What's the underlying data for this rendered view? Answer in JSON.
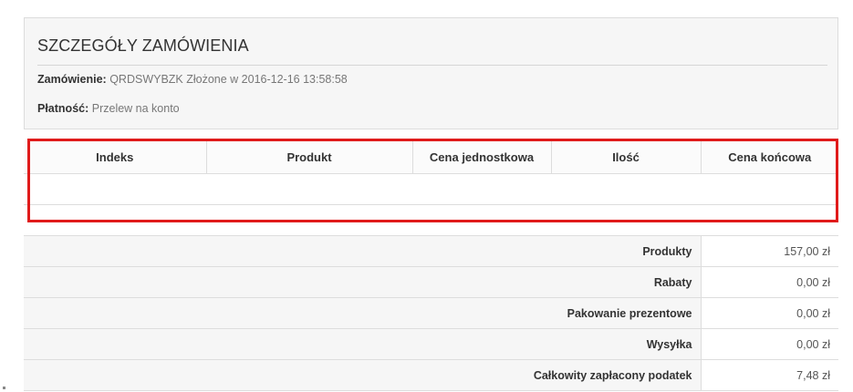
{
  "details": {
    "title": "SZCZEGÓŁY ZAMÓWIENIA",
    "order_label": "Zamówienie:",
    "order_value": "QRDSWYBZK Złożone w 2016-12-16 13:58:58",
    "payment_label": "Płatność:",
    "payment_value": "Przelew na konto"
  },
  "products_table": {
    "columns": [
      "Indeks",
      "Produkt",
      "Cena jednostkowa",
      "Ilość",
      "Cena końcowa"
    ],
    "rows": [
      [
        "",
        "",
        "",
        "",
        ""
      ],
      [
        "",
        "",
        "",
        "",
        ""
      ]
    ]
  },
  "totals": [
    {
      "label": "Produkty",
      "value": "157,00 zł"
    },
    {
      "label": "Rabaty",
      "value": "0,00 zł"
    },
    {
      "label": "Pakowanie prezentowe",
      "value": "0,00 zł"
    },
    {
      "label": "Wysyłka",
      "value": "0,00 zł"
    },
    {
      "label": "Całkowity zapłacony podatek",
      "value": "7,48 zł"
    }
  ],
  "colors": {
    "highlight_border": "#e01b1b",
    "panel_background": "#f6f6f6",
    "grid_line": "#dddddd"
  }
}
